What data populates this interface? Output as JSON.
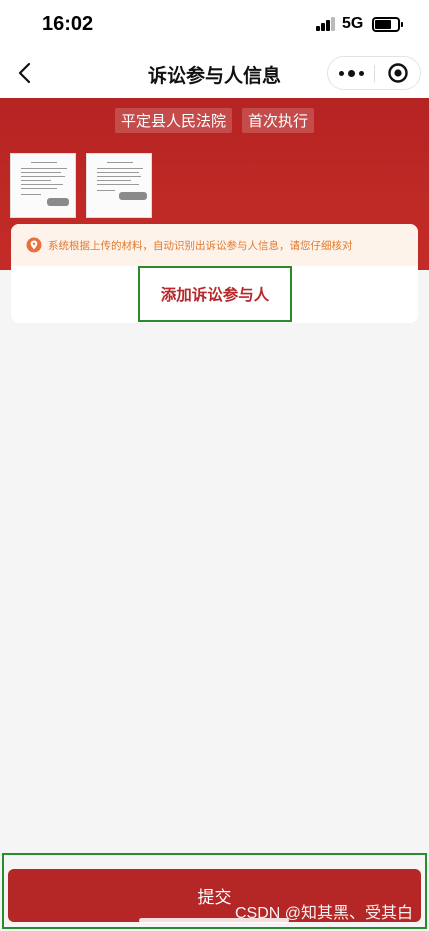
{
  "status": {
    "time": "16:02",
    "network": "5G"
  },
  "nav": {
    "title": "诉讼参与人信息"
  },
  "case": {
    "court": "平定县人民法院",
    "type": "首次执行"
  },
  "notice": {
    "text": "系统根据上传的材料，自动识别出诉讼参与人信息，请您仔细核对"
  },
  "actions": {
    "add_party": "添加诉讼参与人",
    "submit": "提交"
  },
  "watermark": "CSDN @知其黑、受其白",
  "colors": {
    "brand_red": "#b52626",
    "notice_orange": "#e07a2e",
    "highlight_green": "#2b8a2b"
  }
}
